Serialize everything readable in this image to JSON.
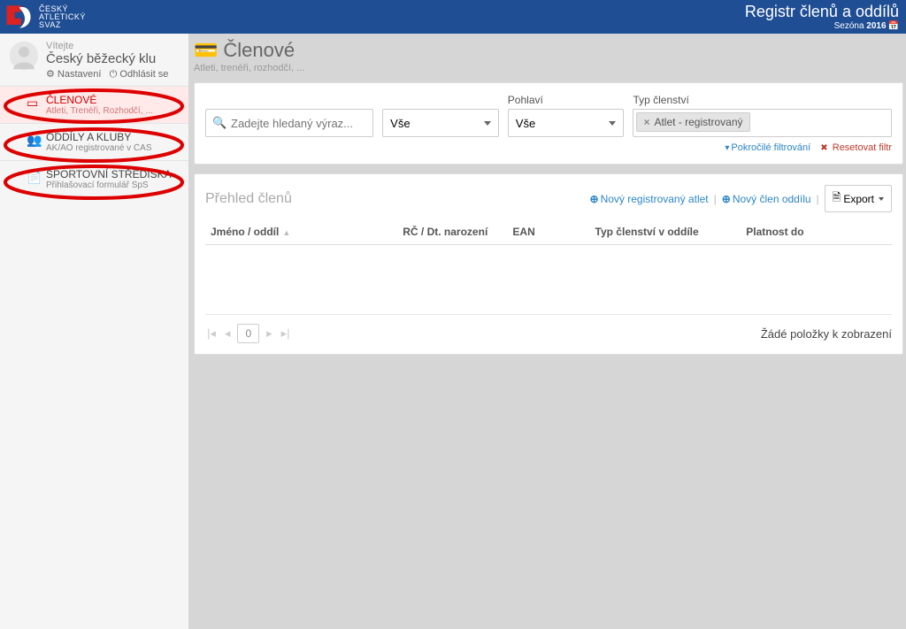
{
  "topbar": {
    "logo_lines": [
      "ČESKÝ",
      "ATLETICKÝ",
      "SVAZ"
    ],
    "title": "Registr členů a oddílů",
    "season_prefix": "Sezóna",
    "season_year": "2016"
  },
  "user": {
    "welcome": "Vítejte",
    "name": "Český běžecký klu",
    "settings": "Nastavení",
    "logout": "Odhlásit se"
  },
  "nav": [
    {
      "title": "ČLENOVÉ",
      "sub": "Atleti, Trenéři, Rozhodčí, ...",
      "icon": "card-icon",
      "active": true
    },
    {
      "title": "ODDÍLY A KLUBY",
      "sub": "AK/AO registrované v ČAS",
      "icon": "group-icon",
      "active": false
    },
    {
      "title": "SPORTOVNÍ STŘEDISKA",
      "sub": "Přihlašovací formulář SpS",
      "icon": "doc-icon",
      "active": false
    }
  ],
  "page": {
    "title": "Členové",
    "subtitle": "Atleti, trenéři, rozhodčí, ..."
  },
  "filters": {
    "search_placeholder": "Zadejte hledaný výraz...",
    "select1_value": "Vše",
    "gender_label": "Pohlaví",
    "gender_value": "Vše",
    "type_label": "Typ členství",
    "type_chip": "Atlet - registrovaný",
    "advanced": "Pokročilé filtrování",
    "reset": "Resetovat filtr"
  },
  "overview": {
    "title": "Přehled členů",
    "new_athlete": "Nový registrovaný atlet",
    "new_member": "Nový člen oddílu",
    "export": "Export",
    "columns": {
      "name": "Jméno / oddíl",
      "rc": "RČ / Dt. narození",
      "ean": "EAN",
      "type": "Typ členství v oddíle",
      "valid": "Platnost do"
    },
    "page_num": "0",
    "empty": "Žádé položky k zobrazení"
  }
}
